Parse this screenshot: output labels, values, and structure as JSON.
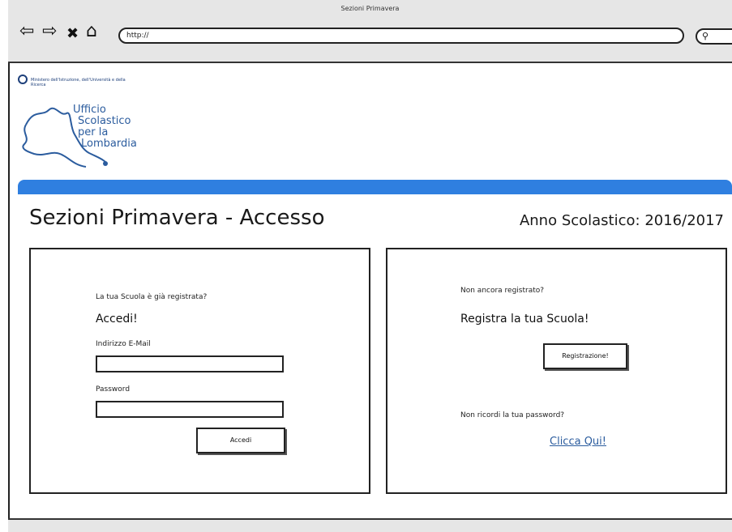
{
  "window": {
    "title": "Sezioni Primavera"
  },
  "toolbar": {
    "back_icon": "⇦",
    "forward_icon": "⇨",
    "stop_icon": "✖",
    "home_icon": "⌂",
    "url": "http://",
    "search_icon": "🔍"
  },
  "logo": {
    "ministry": "Ministero dell'Istruzione, dell'Università e della Ricerca",
    "office_line1": "Ufficio",
    "office_line2": "Scolastico",
    "office_line3": "per la",
    "office_line4": "Lombardia"
  },
  "header": {
    "title": "Sezioni Primavera - Accesso",
    "school_year": "Anno Scolastico: 2016/2017"
  },
  "login": {
    "question": "La tua Scuola è già registrata?",
    "heading": "Accedi!",
    "email_label": "Indirizzo E-Mail",
    "email_value": "",
    "password_label": "Password",
    "password_value": "",
    "submit_label": "Accedi"
  },
  "register": {
    "question": "Non ancora registrato?",
    "heading": "Registra la tua Scuola!",
    "button_label": "Registrazione!",
    "forgot_text": "Non ricordi la tua password?",
    "forgot_link": "Clicca Qui!"
  },
  "colors": {
    "accent_bar": "#2f7fe0",
    "link": "#2b5c9e"
  }
}
